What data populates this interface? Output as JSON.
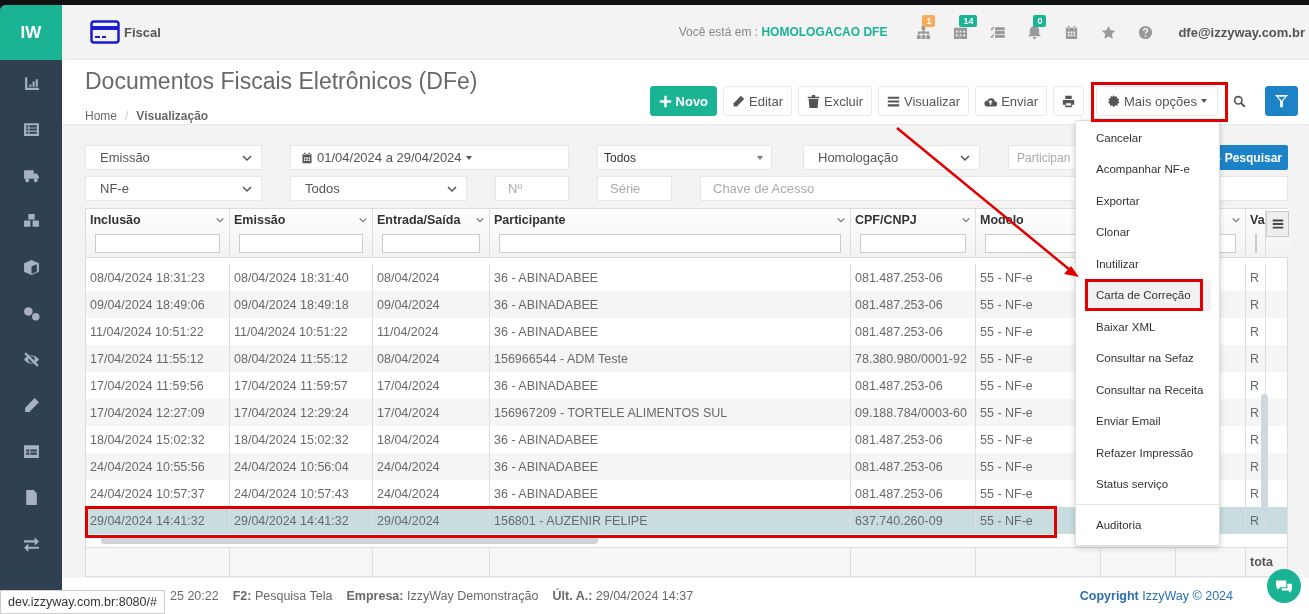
{
  "sidebar": {
    "logo": "IW"
  },
  "header": {
    "module": "Fiscal",
    "environment_label": "Você está em :",
    "environment": "HOMOLOGACAO DFE",
    "user": "dfe@izzyway.com.br",
    "icons": [
      {
        "kind": "sitemap",
        "badge": "1",
        "color": "#f8ac59"
      },
      {
        "kind": "grid",
        "badge": "14",
        "color": "#1ab394"
      },
      {
        "kind": "tasks"
      },
      {
        "kind": "bell",
        "badge": "0",
        "color": "#1ab394"
      },
      {
        "kind": "calendar"
      },
      {
        "kind": "star"
      },
      {
        "kind": "help"
      }
    ]
  },
  "page": {
    "title": "Documentos Fiscais Eletrônicos (DFe)",
    "breadcrumb_separator": "/",
    "breadcrumb": [
      {
        "label": "Home",
        "selected": false
      },
      {
        "label": "Visualização",
        "selected": true
      }
    ]
  },
  "toolbar": [
    {
      "kind": "new",
      "label": "Novo"
    },
    {
      "kind": "edit",
      "label": "Editar"
    },
    {
      "kind": "delete",
      "label": "Excluir"
    },
    {
      "kind": "view",
      "label": "Visualizar"
    },
    {
      "kind": "send",
      "label": "Enviar"
    },
    {
      "kind": "print"
    },
    {
      "kind": "more",
      "label": "Mais opções"
    },
    {
      "kind": "search"
    },
    {
      "kind": "filter"
    }
  ],
  "filters": [
    [
      {
        "kind": "select",
        "value": "Emissão"
      },
      {
        "kind": "daterange",
        "value": "01/04/2024 a 29/04/2024"
      },
      {
        "kind": "dropdown",
        "value": "Todos"
      },
      {
        "kind": "select",
        "value": "Homologação"
      },
      {
        "kind": "input",
        "placeholder": "Participan"
      },
      {
        "kind": "button",
        "label": "Pesquisar"
      }
    ],
    [
      {
        "kind": "select",
        "value": "NF-e"
      },
      {
        "kind": "select",
        "value": "Todos"
      },
      {
        "kind": "input",
        "placeholder": "Nº"
      },
      {
        "kind": "input",
        "placeholder": "Série"
      },
      {
        "kind": "input",
        "placeholder": "Chave de Acesso"
      }
    ]
  ],
  "table": {
    "columns": [
      {
        "kind": "text",
        "label": "Inclusão"
      },
      {
        "kind": "text",
        "label": "Emissão"
      },
      {
        "kind": "text",
        "label": "Entrada/Saída"
      },
      {
        "kind": "text",
        "label": "Participante"
      },
      {
        "kind": "text",
        "label": "CPF/CNPJ"
      },
      {
        "kind": "label_only",
        "label": "Modelo"
      },
      {
        "kind": "hidden"
      },
      {
        "kind": "covered"
      },
      {
        "kind": "text",
        "label": "Va"
      }
    ],
    "rows": [
      {
        "inclusao": "08/04/2024 18:31:23",
        "emissao": "08/04/2024 18:31:40",
        "entrada_saida": "08/04/2024",
        "participante": "36 - ABINADABEE",
        "cpf_cnpj": "081.487.253-06",
        "modelo": "55 - NF-e",
        "column_9": "R",
        "selected": false
      },
      {
        "inclusao": "09/04/2024 18:49:06",
        "emissao": "09/04/2024 18:49:18",
        "entrada_saida": "09/04/2024",
        "participante": "36 - ABINADABEE",
        "cpf_cnpj": "081.487.253-06",
        "modelo": "55 - NF-e",
        "column_9": "R",
        "selected": false
      },
      {
        "inclusao": "11/04/2024 10:51:22",
        "emissao": "11/04/2024 10:51:22",
        "entrada_saida": "11/04/2024",
        "participante": "36 - ABINADABEE",
        "cpf_cnpj": "081.487.253-06",
        "modelo": "55 - NF-e",
        "column_9": "R",
        "selected": false
      },
      {
        "inclusao": "17/04/2024 11:55:12",
        "emissao": "08/04/2024 11:55:12",
        "entrada_saida": "08/04/2024",
        "participante": "156966544 - ADM Teste",
        "cpf_cnpj": "78.380.980/0001-92",
        "modelo": "55 - NF-e",
        "column_9": "R",
        "selected": false
      },
      {
        "inclusao": "17/04/2024 11:59:56",
        "emissao": "17/04/2024 11:59:57",
        "entrada_saida": "17/04/2024",
        "participante": "36 - ABINADABEE",
        "cpf_cnpj": "081.487.253-06",
        "modelo": "55 - NF-e",
        "column_9": "R",
        "selected": false
      },
      {
        "inclusao": "17/04/2024 12:27:09",
        "emissao": "17/04/2024 12:29:24",
        "entrada_saida": "17/04/2024",
        "participante": "156967209 - TORTELE ALIMENTOS SUL",
        "cpf_cnpj": "09.188.784/0003-60",
        "modelo": "55 - NF-e",
        "column_9": "R",
        "selected": false
      },
      {
        "inclusao": "18/04/2024 15:02:32",
        "emissao": "18/04/2024 15:02:32",
        "entrada_saida": "18/04/2024",
        "participante": "36 - ABINADABEE",
        "cpf_cnpj": "081.487.253-06",
        "modelo": "55 - NF-e",
        "column_9": "R",
        "selected": false
      },
      {
        "inclusao": "24/04/2024 10:55:56",
        "emissao": "24/04/2024 10:56:04",
        "entrada_saida": "24/04/2024",
        "participante": "36 - ABINADABEE",
        "cpf_cnpj": "081.487.253-06",
        "modelo": "55 - NF-e",
        "column_9": "R",
        "selected": false
      },
      {
        "inclusao": "24/04/2024 10:57:37",
        "emissao": "24/04/2024 10:57:43",
        "entrada_saida": "24/04/2024",
        "participante": "36 - ABINADABEE",
        "cpf_cnpj": "081.487.253-06",
        "modelo": "55 - NF-e",
        "column_9": "R",
        "selected": false
      },
      {
        "inclusao": "29/04/2024 14:41:32",
        "emissao": "29/04/2024 14:41:32",
        "entrada_saida": "29/04/2024",
        "participante": "156801 - AUZENIR FELIPE",
        "cpf_cnpj": "637.740.260-09",
        "modelo": "55 - NF-e",
        "column_9": "R",
        "selected": true
      }
    ],
    "footer": {
      "column_9": "tota"
    }
  },
  "menu": {
    "groups": [
      {
        "items": [
          {
            "label": "Cancelar",
            "selected": false
          },
          {
            "label": "Acompanhar NF-e",
            "selected": false
          },
          {
            "label": "Exportar",
            "selected": false
          },
          {
            "label": "Clonar",
            "selected": false
          },
          {
            "label": "Inutilizar",
            "selected": false
          },
          {
            "label": "Carta de Correção",
            "selected": true
          },
          {
            "label": "Baixar XML",
            "selected": false
          },
          {
            "label": "Consultar na Sefaz",
            "selected": false
          },
          {
            "label": "Consultar na Receita",
            "selected": false
          },
          {
            "label": "Enviar Email",
            "selected": false
          },
          {
            "label": "Refazer Impressão",
            "selected": false
          },
          {
            "label": "Status serviço",
            "selected": false
          }
        ]
      },
      {
        "items": [
          {
            "label": "Auditoria",
            "selected": false
          }
        ]
      }
    ]
  },
  "annotations": [
    {
      "kind": "box"
    },
    {
      "kind": "box"
    },
    {
      "kind": "box"
    },
    {
      "kind": "arrow"
    }
  ],
  "status_bar": {
    "items": [
      "25 20:22",
      "**F2:** Pesquisa Tela",
      "**Empresa:** IzzyWay Demonstração",
      "**Últ. A.:** 29/04/2024 14:37"
    ],
    "copyright": "**Copyright** IzzyWay © 2024",
    "link_preview": "dev.izzyway.com.br:8080/#"
  }
}
